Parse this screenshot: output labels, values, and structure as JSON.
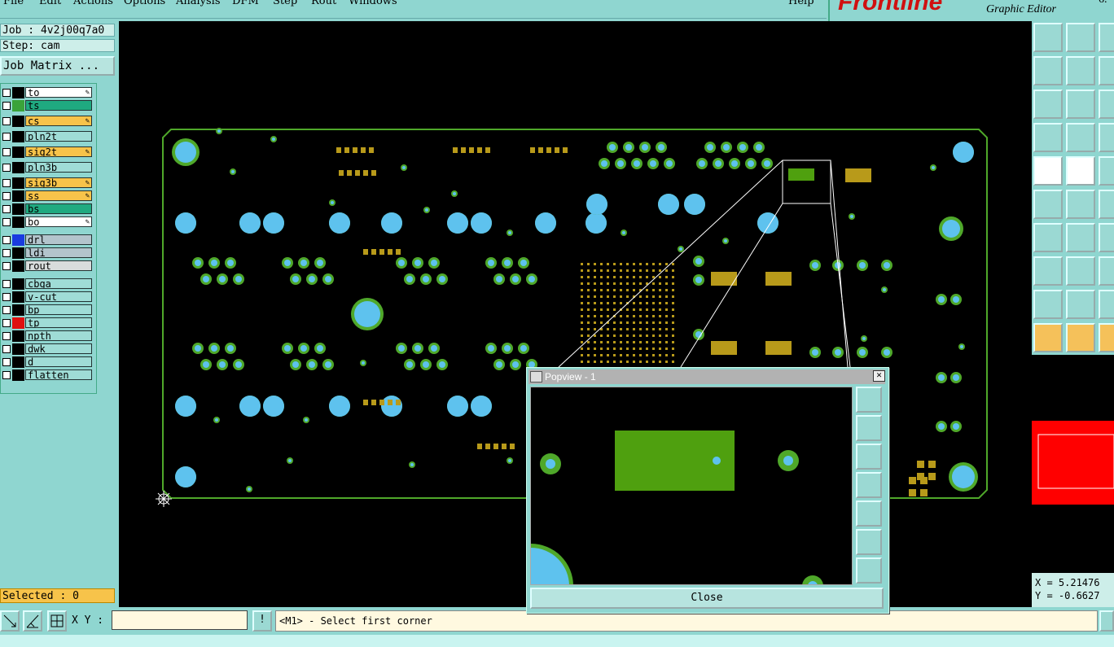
{
  "menu": {
    "items": [
      "File",
      "Edit",
      "Actions",
      "Options",
      "Analysis",
      "DFM",
      "Step",
      "Rout",
      "Windows"
    ],
    "help": "Help"
  },
  "brand": {
    "logo": "Frontline",
    "subtitle": "Graphic Editor",
    "version": "6."
  },
  "job": {
    "job_line": "Job : 4v2j00q7a0",
    "step_line": "Step: cam",
    "matrix_button": "Job Matrix ..."
  },
  "layers": [
    {
      "name": "to",
      "swatch": "#000000",
      "bg": "#ffffff",
      "editable": true
    },
    {
      "name": "ts",
      "swatch": "#3aa33a",
      "bg": "#1faa80",
      "editable": false
    },
    {
      "name": "cs",
      "swatch": "#000000",
      "bg": "#f7c34a",
      "editable": true
    },
    {
      "name": "pln2t",
      "swatch": "#000000",
      "bg": "#9fdcd6",
      "editable": false
    },
    {
      "name": "sig2t",
      "swatch": "#000000",
      "bg": "#f7c34a",
      "editable": true
    },
    {
      "name": "pln3b",
      "swatch": "#000000",
      "bg": "#9fdcd6",
      "editable": false
    },
    {
      "name": "sig3b",
      "swatch": "#000000",
      "bg": "#f7c34a",
      "editable": true
    },
    {
      "name": "ss",
      "swatch": "#000000",
      "bg": "#f7c34a",
      "editable": true
    },
    {
      "name": "bs",
      "swatch": "#000000",
      "bg": "#1faa80",
      "editable": false
    },
    {
      "name": "bo",
      "swatch": "#000000",
      "bg": "#ffffff",
      "editable": true
    },
    {
      "name": "drl",
      "swatch": "#1a3be0",
      "bg": "#b3c4cc",
      "editable": false
    },
    {
      "name": "ldi",
      "swatch": "#000000",
      "bg": "#b3c4cc",
      "editable": false
    },
    {
      "name": "rout",
      "swatch": "#000000",
      "bg": "#d8dcdc",
      "editable": false
    },
    {
      "name": "cbga",
      "swatch": "#000000",
      "bg": "#9fdcd6",
      "editable": false
    },
    {
      "name": "v-cut",
      "swatch": "#000000",
      "bg": "#9fdcd6",
      "editable": false
    },
    {
      "name": "bp",
      "swatch": "#000000",
      "bg": "#9fdcd6",
      "editable": false
    },
    {
      "name": "tp",
      "swatch": "#e01010",
      "bg": "#9fdcd6",
      "editable": false
    },
    {
      "name": "npth",
      "swatch": "#000000",
      "bg": "#9fdcd6",
      "editable": false
    },
    {
      "name": "dwk",
      "swatch": "#000000",
      "bg": "#9fdcd6",
      "editable": false
    },
    {
      "name": "d",
      "swatch": "#000000",
      "bg": "#9fdcd6",
      "editable": false
    },
    {
      "name": "flatten",
      "swatch": "#000000",
      "bg": "#9fdcd6",
      "editable": false
    }
  ],
  "selection": {
    "label": "Selected : 0"
  },
  "coords": {
    "x": "X = 5.21476",
    "y": "Y = -0.6627"
  },
  "command": {
    "xy_label": "X Y :",
    "xy_value": "",
    "bang": "!",
    "status": "<M1> - Select first corner"
  },
  "popview": {
    "title": "Popview - 1",
    "close_label": "Close"
  },
  "colors": {
    "board_outline": "#4fa82a",
    "pad_cyan": "#5ec2ee",
    "pad_ring": "#4fa82a",
    "smd_yellow": "#b89a1a",
    "canvas": "#000000"
  }
}
